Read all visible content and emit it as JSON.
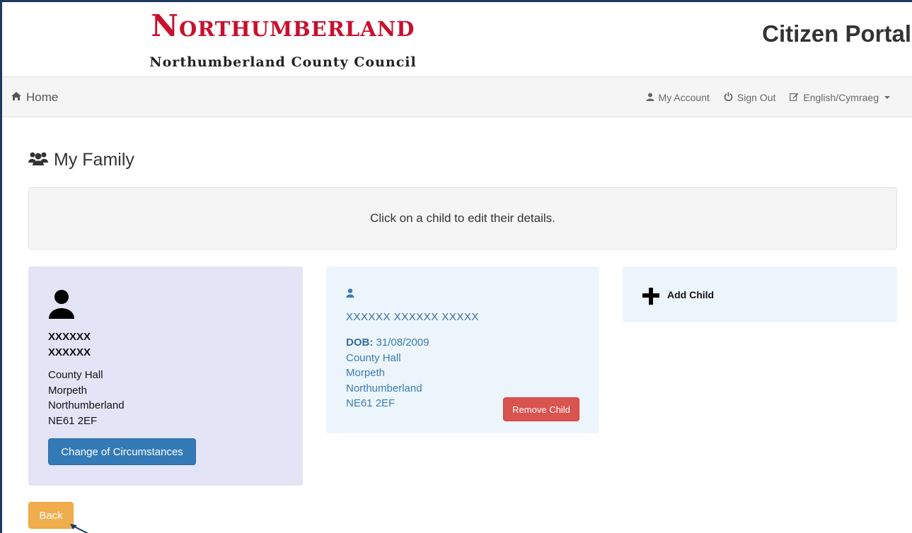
{
  "header": {
    "logo_wordmark": "Northumberland",
    "logo_subtitle": "Northumberland County Council",
    "portal_title": "Citizen Portal"
  },
  "navbar": {
    "home_label": "Home",
    "my_account_label": "My Account",
    "sign_out_label": "Sign Out",
    "language_label": "English/Cymraeg"
  },
  "page": {
    "title": "My Family",
    "instruction": "Click on a child to edit their details."
  },
  "parent": {
    "name_line1": "XXXXXX",
    "name_line2": "XXXXXX",
    "address": [
      "County Hall",
      "Morpeth",
      "Northumberland",
      "NE61 2EF"
    ],
    "change_button_label": "Change of Circumstances"
  },
  "child": {
    "name": "XXXXXX XXXXXX XXXXX",
    "dob_label": "DOB:",
    "dob_value": "31/08/2009",
    "address": [
      "County Hall",
      "Morpeth",
      "Northumberland",
      "NE61 2EF"
    ],
    "remove_button_label": "Remove Child"
  },
  "add_child": {
    "label": "Add Child"
  },
  "footer": {
    "back_button_label": "Back"
  },
  "colors": {
    "brand_red": "#c8102e",
    "primary_blue": "#337ab7",
    "danger_red": "#d9534f",
    "warning_orange": "#f0ad4e",
    "parent_card_bg": "#e4e4f7",
    "child_card_bg": "#edf5fc"
  }
}
